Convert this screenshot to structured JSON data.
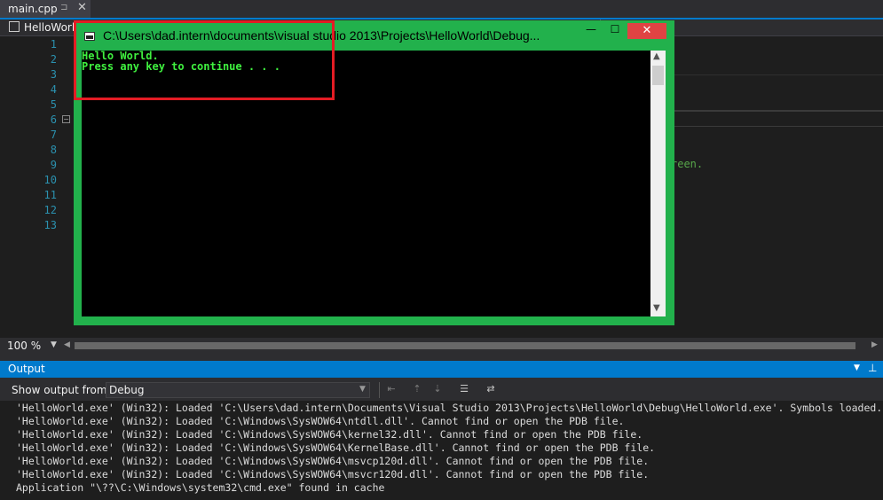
{
  "tab": {
    "label": "main.cpp",
    "pin": "⊐",
    "close": "✕"
  },
  "nav": {
    "project": "HelloWorld"
  },
  "editor": {
    "line_numbers": [
      "1",
      "2",
      "3",
      "4",
      "5",
      "6",
      "7",
      "8",
      "9",
      "10",
      "11",
      "12",
      "13"
    ],
    "fold_marker": "−",
    "visible_fragment": "reen."
  },
  "zoom": {
    "value": "100 %",
    "arrow": "▼"
  },
  "console": {
    "title": "C:\\Users\\dad.intern\\documents\\visual studio 2013\\Projects\\HelloWorld\\Debug...",
    "minimize": "—",
    "maximize": "☐",
    "close": "✕",
    "lines": [
      "Hello World.",
      "Press any key to continue . . ."
    ]
  },
  "output": {
    "title": "Output",
    "show_from_label": "Show output from:",
    "source": "Debug",
    "lines": [
      "'HelloWorld.exe' (Win32): Loaded 'C:\\Users\\dad.intern\\Documents\\Visual Studio 2013\\Projects\\HelloWorld\\Debug\\HelloWorld.exe'. Symbols loaded.",
      "'HelloWorld.exe' (Win32): Loaded 'C:\\Windows\\SysWOW64\\ntdll.dll'. Cannot find or open the PDB file.",
      "'HelloWorld.exe' (Win32): Loaded 'C:\\Windows\\SysWOW64\\kernel32.dll'. Cannot find or open the PDB file.",
      "'HelloWorld.exe' (Win32): Loaded 'C:\\Windows\\SysWOW64\\KernelBase.dll'. Cannot find or open the PDB file.",
      "'HelloWorld.exe' (Win32): Loaded 'C:\\Windows\\SysWOW64\\msvcp120d.dll'. Cannot find or open the PDB file.",
      "'HelloWorld.exe' (Win32): Loaded 'C:\\Windows\\SysWOW64\\msvcr120d.dll'. Cannot find or open the PDB file.",
      "Application \"\\??\\C:\\Windows\\system32\\cmd.exe\" found in cache"
    ]
  },
  "colors": {
    "accent": "#007acc",
    "console_frame": "#22b14c",
    "console_text": "#3ff03f",
    "highlight": "#e41c24"
  }
}
